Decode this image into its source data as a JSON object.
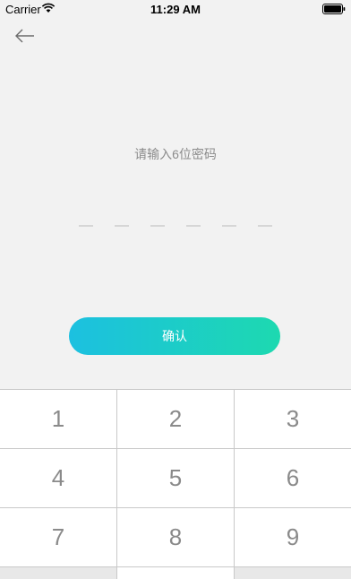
{
  "status_bar": {
    "carrier": "Carrier",
    "time": "11:29 AM"
  },
  "nav": {
    "back_icon": "arrow-left-icon"
  },
  "pin": {
    "prompt": "请输入6位密码",
    "length": 6,
    "entered": 0
  },
  "confirm": {
    "label": "确认",
    "gradient_start": "#1cc0e0",
    "gradient_end": "#1dd9b0"
  },
  "keypad": {
    "keys": [
      "1",
      "2",
      "3",
      "4",
      "5",
      "6",
      "7",
      "8",
      "9"
    ]
  },
  "colors": {
    "background": "#f2f2f2",
    "key_text": "#8a8a8a",
    "prompt_text": "#8c8c8c",
    "dash": "#d6d6d6"
  }
}
